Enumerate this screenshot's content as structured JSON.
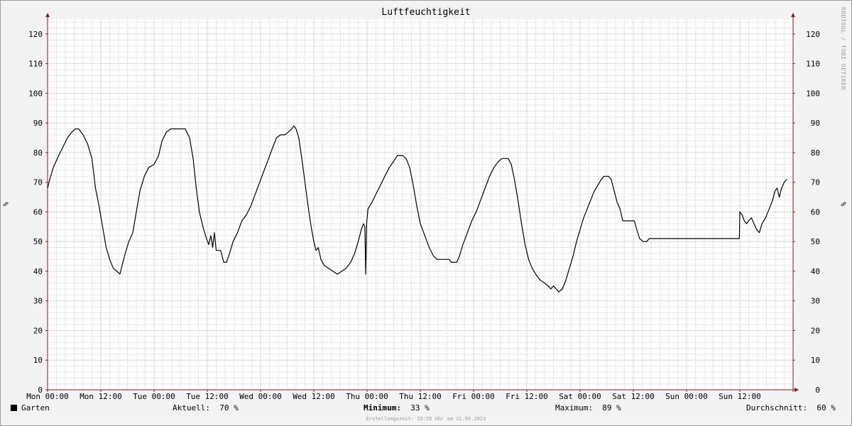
{
  "title": "Luftfeuchtigkeit",
  "watermark": "RRDTOOL / TOBI OETIKER",
  "unit_label": "%",
  "legend": {
    "series_name": "Garten",
    "stats": [
      {
        "label": "Aktuell:",
        "value": "70 %",
        "bold": false
      },
      {
        "label": "Minimum:",
        "value": "33 %",
        "bold": true
      },
      {
        "label": "Maximum:",
        "value": "89 %",
        "bold": false
      },
      {
        "label": "Durchschnitt:",
        "value": "60 %",
        "bold": false
      }
    ]
  },
  "footer": "Erstellungszeit: 23:55 Uhr am 21.05.2023",
  "colors": {
    "background": "#f3f3f3",
    "plot_background": "#ffffff",
    "minor_grid": "#d4d4d4",
    "major_grid": "#f0a0a0",
    "axis": "#8b1a1a",
    "line": "#000000"
  },
  "chart_data": {
    "type": "line",
    "title": "Luftfeuchtigkeit",
    "ylim": [
      0,
      125
    ],
    "yticks": [
      0,
      10,
      20,
      30,
      40,
      50,
      60,
      70,
      80,
      90,
      100,
      110,
      120
    ],
    "ylabel": "%",
    "xlim_hours": [
      0,
      168
    ],
    "xticks": [
      {
        "hour": 0,
        "label": "Mon 00:00"
      },
      {
        "hour": 12,
        "label": "Mon 12:00"
      },
      {
        "hour": 24,
        "label": "Tue 00:00"
      },
      {
        "hour": 36,
        "label": "Tue 12:00"
      },
      {
        "hour": 48,
        "label": "Wed 00:00"
      },
      {
        "hour": 60,
        "label": "Wed 12:00"
      },
      {
        "hour": 72,
        "label": "Thu 00:00"
      },
      {
        "hour": 84,
        "label": "Thu 12:00"
      },
      {
        "hour": 96,
        "label": "Fri 00:00"
      },
      {
        "hour": 108,
        "label": "Fri 12:00"
      },
      {
        "hour": 120,
        "label": "Sat 00:00"
      },
      {
        "hour": 132,
        "label": "Sat 12:00"
      },
      {
        "hour": 144,
        "label": "Sun 00:00"
      },
      {
        "hour": 156,
        "label": "Sun 12:00"
      }
    ],
    "grid": true,
    "series": [
      {
        "name": "Garten",
        "color": "#000000",
        "points": [
          [
            0.0,
            68
          ],
          [
            0.5,
            71
          ],
          [
            1.3,
            75
          ],
          [
            2.5,
            79
          ],
          [
            3.5,
            82
          ],
          [
            4.5,
            85
          ],
          [
            5.5,
            87
          ],
          [
            6.3,
            88
          ],
          [
            7.0,
            88
          ],
          [
            8.0,
            86
          ],
          [
            9.0,
            83
          ],
          [
            10.0,
            78
          ],
          [
            10.8,
            68
          ],
          [
            11.6,
            62
          ],
          [
            12.4,
            55
          ],
          [
            13.2,
            48
          ],
          [
            14.0,
            44
          ],
          [
            14.8,
            41
          ],
          [
            15.6,
            40
          ],
          [
            16.3,
            39
          ],
          [
            16.8,
            42
          ],
          [
            17.5,
            46
          ],
          [
            18.3,
            50
          ],
          [
            19.2,
            53
          ],
          [
            20.0,
            60
          ],
          [
            20.8,
            67
          ],
          [
            21.8,
            72
          ],
          [
            22.8,
            75
          ],
          [
            24.0,
            76
          ],
          [
            25.0,
            79
          ],
          [
            25.8,
            84
          ],
          [
            26.8,
            87
          ],
          [
            27.8,
            88
          ],
          [
            29.0,
            88
          ],
          [
            30.0,
            88
          ],
          [
            31.0,
            88
          ],
          [
            32.0,
            85
          ],
          [
            32.8,
            78
          ],
          [
            33.5,
            68
          ],
          [
            34.2,
            60
          ],
          [
            35.0,
            55
          ],
          [
            35.8,
            51
          ],
          [
            36.3,
            49
          ],
          [
            36.8,
            52
          ],
          [
            37.2,
            48
          ],
          [
            37.6,
            53
          ],
          [
            38.0,
            47
          ],
          [
            39.0,
            47
          ],
          [
            39.7,
            43
          ],
          [
            40.3,
            43
          ],
          [
            41.0,
            46
          ],
          [
            41.8,
            50
          ],
          [
            42.8,
            53
          ],
          [
            43.8,
            57
          ],
          [
            44.8,
            59
          ],
          [
            45.8,
            62
          ],
          [
            46.8,
            66
          ],
          [
            47.8,
            70
          ],
          [
            48.8,
            74
          ],
          [
            49.8,
            78
          ],
          [
            50.8,
            82
          ],
          [
            51.6,
            85
          ],
          [
            52.5,
            86
          ],
          [
            53.5,
            86
          ],
          [
            54.3,
            87
          ],
          [
            55.0,
            88
          ],
          [
            55.5,
            89
          ],
          [
            56.0,
            88
          ],
          [
            56.6,
            85
          ],
          [
            57.3,
            78
          ],
          [
            58.0,
            70
          ],
          [
            58.7,
            62
          ],
          [
            59.4,
            55
          ],
          [
            60.0,
            50
          ],
          [
            60.5,
            47
          ],
          [
            61.0,
            48
          ],
          [
            61.6,
            44
          ],
          [
            62.3,
            42
          ],
          [
            63.3,
            41
          ],
          [
            64.3,
            40
          ],
          [
            65.3,
            39
          ],
          [
            66.3,
            40
          ],
          [
            67.3,
            41
          ],
          [
            68.3,
            43
          ],
          [
            69.2,
            46
          ],
          [
            70.0,
            50
          ],
          [
            70.7,
            54
          ],
          [
            71.2,
            56
          ],
          [
            71.5,
            55
          ],
          [
            71.7,
            39
          ],
          [
            71.9,
            56
          ],
          [
            72.2,
            61
          ],
          [
            73.0,
            63
          ],
          [
            74.0,
            66
          ],
          [
            75.0,
            69
          ],
          [
            76.0,
            72
          ],
          [
            77.0,
            75
          ],
          [
            78.0,
            77
          ],
          [
            78.8,
            79
          ],
          [
            80.0,
            79
          ],
          [
            80.8,
            78
          ],
          [
            81.6,
            75
          ],
          [
            82.4,
            69
          ],
          [
            83.2,
            62
          ],
          [
            84.0,
            56
          ],
          [
            85.0,
            52
          ],
          [
            86.0,
            48
          ],
          [
            87.0,
            45
          ],
          [
            87.8,
            44
          ],
          [
            89.5,
            44
          ],
          [
            90.5,
            44
          ],
          [
            91.0,
            43
          ],
          [
            92.2,
            43
          ],
          [
            92.8,
            45
          ],
          [
            93.6,
            49
          ],
          [
            94.6,
            53
          ],
          [
            95.6,
            57
          ],
          [
            96.6,
            60
          ],
          [
            97.6,
            64
          ],
          [
            98.6,
            68
          ],
          [
            99.6,
            72
          ],
          [
            100.6,
            75
          ],
          [
            101.6,
            77
          ],
          [
            102.4,
            78
          ],
          [
            103.8,
            78
          ],
          [
            104.5,
            76
          ],
          [
            105.2,
            71
          ],
          [
            106.0,
            64
          ],
          [
            106.8,
            56
          ],
          [
            107.6,
            49
          ],
          [
            108.4,
            44
          ],
          [
            109.2,
            41
          ],
          [
            110.0,
            39
          ],
          [
            111.0,
            37
          ],
          [
            112.0,
            36
          ],
          [
            112.8,
            35
          ],
          [
            113.4,
            34
          ],
          [
            114.0,
            35
          ],
          [
            114.6,
            34
          ],
          [
            115.2,
            33
          ],
          [
            116.0,
            34
          ],
          [
            116.8,
            37
          ],
          [
            117.6,
            41
          ],
          [
            118.4,
            45
          ],
          [
            119.2,
            50
          ],
          [
            120.0,
            54
          ],
          [
            120.8,
            58
          ],
          [
            121.6,
            61
          ],
          [
            122.4,
            64
          ],
          [
            123.2,
            67
          ],
          [
            124.0,
            69
          ],
          [
            124.8,
            71
          ],
          [
            125.4,
            72
          ],
          [
            126.4,
            72
          ],
          [
            127.0,
            71
          ],
          [
            127.7,
            67
          ],
          [
            128.4,
            63
          ],
          [
            129.0,
            61
          ],
          [
            129.6,
            57
          ],
          [
            131.0,
            57
          ],
          [
            132.2,
            57
          ],
          [
            132.8,
            54
          ],
          [
            133.4,
            51
          ],
          [
            134.2,
            50
          ],
          [
            135.0,
            50
          ],
          [
            135.6,
            51
          ],
          [
            136.5,
            51
          ],
          [
            137.2,
            51
          ],
          [
            155.9,
            51
          ],
          [
            156.0,
            60
          ],
          [
            156.5,
            59
          ],
          [
            157.0,
            57
          ],
          [
            157.5,
            56
          ],
          [
            158.0,
            57
          ],
          [
            158.6,
            58
          ],
          [
            159.2,
            56
          ],
          [
            159.8,
            54
          ],
          [
            160.4,
            53
          ],
          [
            161.0,
            56
          ],
          [
            161.8,
            58
          ],
          [
            162.6,
            61
          ],
          [
            163.4,
            64
          ],
          [
            163.9,
            67
          ],
          [
            164.4,
            68
          ],
          [
            164.9,
            65
          ],
          [
            165.4,
            68
          ],
          [
            166.0,
            70
          ],
          [
            166.6,
            71
          ]
        ]
      }
    ]
  }
}
